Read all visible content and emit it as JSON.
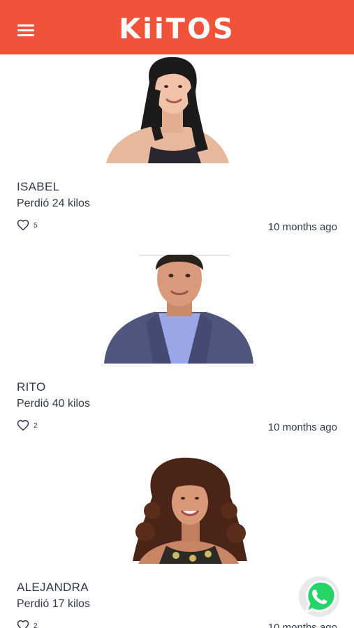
{
  "header": {
    "logo_text": "KiiTOS",
    "brand_color": "#f0533a",
    "menu_icon": "hamburger-menu-icon"
  },
  "posts": [
    {
      "name": "ISABEL",
      "subtitle": "Perdió 24 kilos",
      "likes": "5",
      "time": "10 months ago"
    },
    {
      "name": "RITO",
      "subtitle": "Perdió 40 kilos",
      "likes": "2",
      "time": "10 months ago"
    },
    {
      "name": "ALEJANDRA",
      "subtitle": "Perdió 17 kilos",
      "likes": "2",
      "time": "10 months ago"
    }
  ],
  "floating": {
    "whatsapp_icon": "whatsapp-icon",
    "whatsapp_color": "#25d366"
  },
  "text_color": "#2f3a4c"
}
